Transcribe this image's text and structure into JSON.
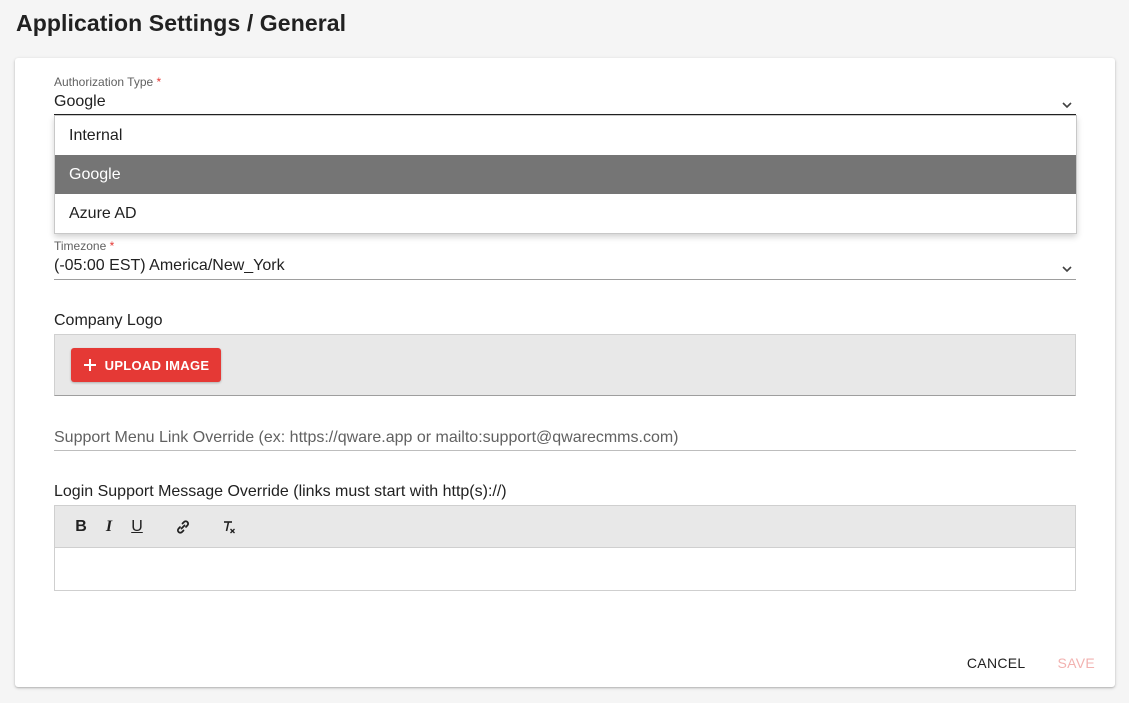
{
  "page": {
    "title": "Application Settings / General"
  },
  "auth": {
    "label": "Authorization Type",
    "required_mark": "*",
    "value": "Google",
    "options": [
      "Internal",
      "Google",
      "Azure AD"
    ]
  },
  "timezone": {
    "label": "Timezone",
    "required_mark": "*",
    "value": "(-05:00 EST) America/New_York"
  },
  "logo": {
    "label": "Company Logo",
    "upload_label": "UPLOAD IMAGE"
  },
  "support_link": {
    "placeholder": "Support Menu Link Override (ex: https://qware.app or mailto:support@qwarecmms.com)"
  },
  "login_message": {
    "label": "Login Support Message Override (links must start with http(s)://)",
    "toolbar": {
      "bold": "B",
      "italic": "I",
      "underline": "U"
    }
  },
  "actions": {
    "cancel": "CANCEL",
    "save": "SAVE"
  },
  "colors": {
    "accent": "#e53935",
    "selected_option_bg": "#757575",
    "save_disabled": "#f2b2b0"
  }
}
